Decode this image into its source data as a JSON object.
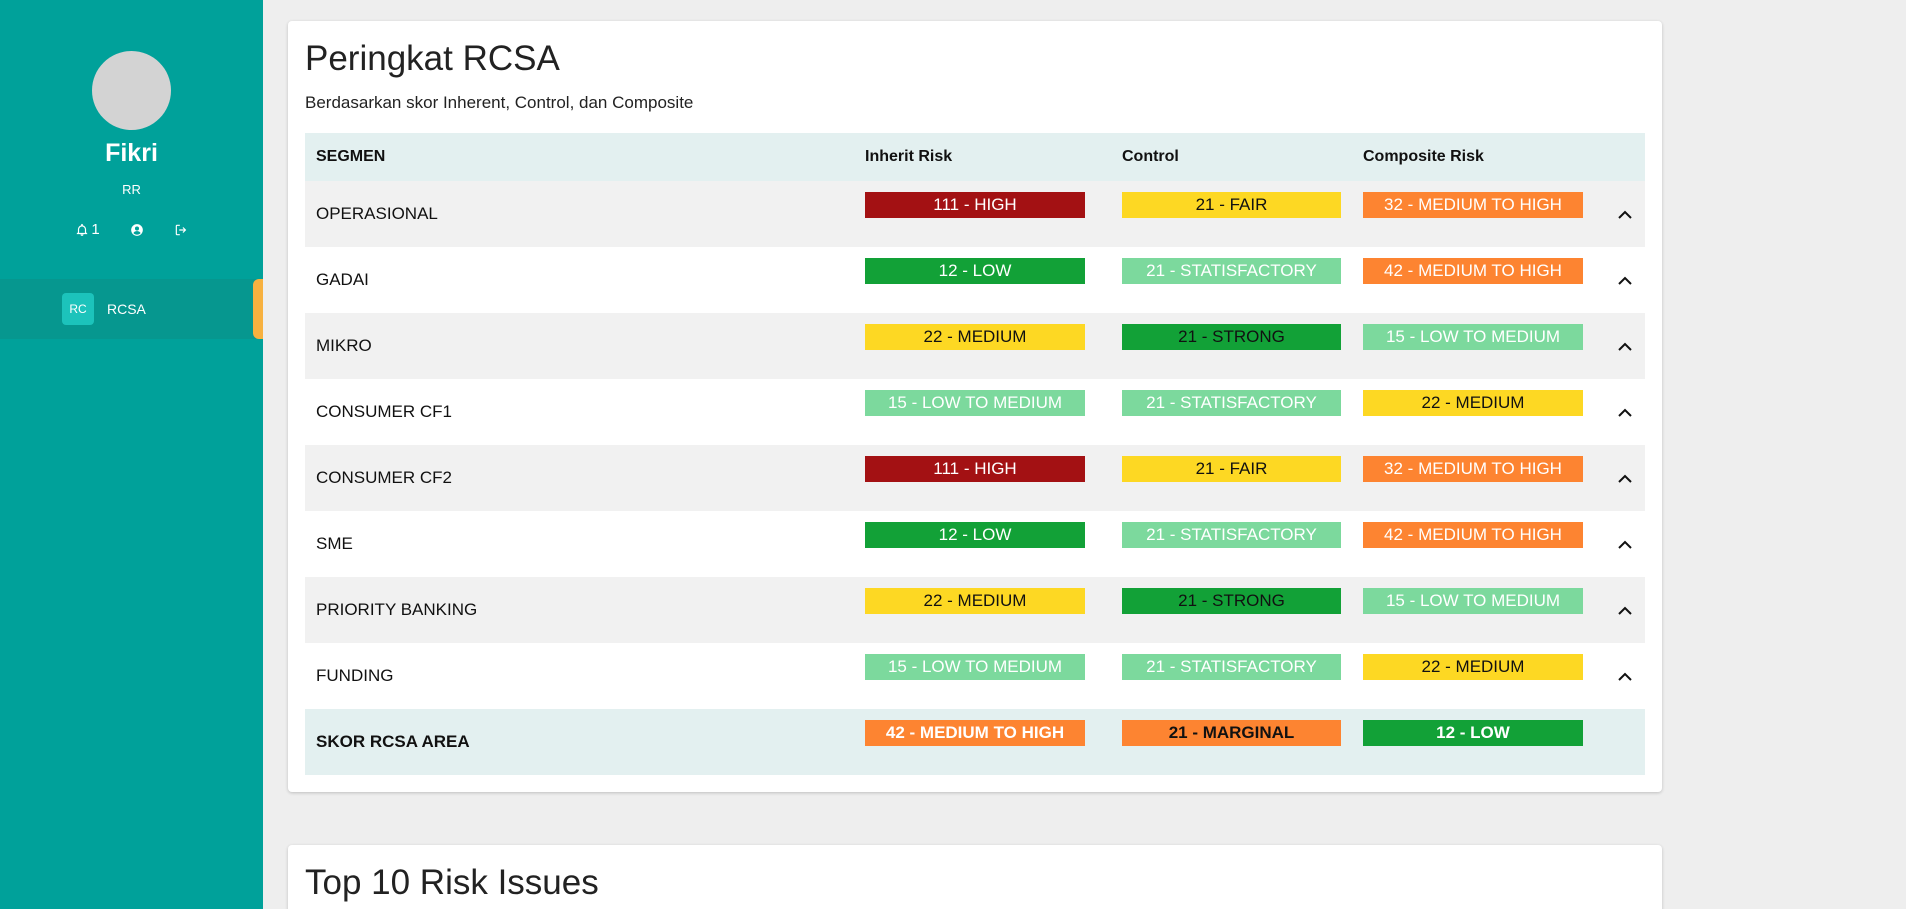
{
  "sidebar": {
    "user_name": "Fikri",
    "user_role": "RR",
    "notification_count": "1",
    "nav_items": [
      {
        "badge": "RC",
        "label": "RCSA"
      }
    ],
    "bg_color": "#00a19a",
    "accent_color": "#f7b13f"
  },
  "rcsa": {
    "title": "Peringkat RCSA",
    "subtitle": "Berdasarkan skor Inherent, Control, dan Composite",
    "columns": {
      "segment": "SEGMEN",
      "inherit": "Inherit Risk",
      "control": "Control",
      "composite": "Composite Risk"
    },
    "rows": [
      {
        "segment": "OPERASIONAL",
        "inherit": "111 - HIGH",
        "control": "21 - FAIR",
        "composite": "32 - MEDIUM TO HIGH"
      },
      {
        "segment": "GADAI",
        "inherit": "12 - LOW",
        "control": "21 - STATISFACTORY",
        "composite": "42 - MEDIUM TO HIGH"
      },
      {
        "segment": "MIKRO",
        "inherit": "22 - MEDIUM",
        "control": "21 - STRONG",
        "composite": "15 - LOW TO MEDIUM"
      },
      {
        "segment": "CONSUMER CF1",
        "inherit": "15 - LOW TO MEDIUM",
        "control": "21 - STATISFACTORY",
        "composite": "22 - MEDIUM"
      },
      {
        "segment": "CONSUMER CF2",
        "inherit": "111 - HIGH",
        "control": "21 - FAIR",
        "composite": "32 - MEDIUM TO HIGH"
      },
      {
        "segment": "SME",
        "inherit": "12 - LOW",
        "control": "21 - STATISFACTORY",
        "composite": "42 - MEDIUM TO HIGH"
      },
      {
        "segment": "PRIORITY BANKING",
        "inherit": "22 - MEDIUM",
        "control": "21 - STRONG",
        "composite": "15 - LOW TO MEDIUM"
      },
      {
        "segment": "FUNDING",
        "inherit": "15 - LOW TO MEDIUM",
        "control": "21 - STATISFACTORY",
        "composite": "22 - MEDIUM"
      }
    ],
    "footer": {
      "segment": "SKOR RCSA AREA",
      "inherit": "42 - MEDIUM TO HIGH",
      "control": "21 - MARGINAL",
      "composite": "12 - LOW"
    },
    "level_colors": {
      "HIGH": {
        "bg": "#a31113",
        "fg": "#ffffff"
      },
      "LOW": {
        "bg": "#12a137",
        "fg": "#ffffff"
      },
      "MEDIUM": {
        "bg": "#fdd823",
        "fg": "#111111"
      },
      "LOW TO MEDIUM": {
        "bg": "#7cd99d",
        "fg": "#ffffff"
      },
      "MEDIUM TO HIGH": {
        "bg": "#fd8431",
        "fg": "#ffffff"
      },
      "FAIR": {
        "bg": "#fdd823",
        "fg": "#111111"
      },
      "STATISFACTORY": {
        "bg": "#7cd99d",
        "fg": "#ffffff"
      },
      "STRONG": {
        "bg": "#12a137",
        "fg": "#111111"
      },
      "MARGINAL": {
        "bg": "#fd8431",
        "fg": "#111111"
      }
    }
  },
  "top_issues": {
    "title": "Top 10 Risk Issues"
  }
}
